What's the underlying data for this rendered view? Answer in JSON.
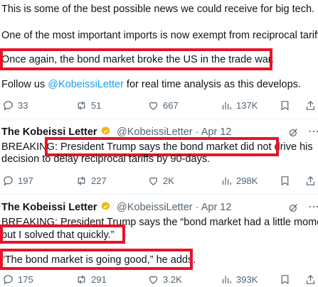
{
  "tweet1": {
    "line1": "This is some of the best possible news we could receive for big tech.",
    "line2": "One of the most important imports is now exempt from reciprocal tariffs.",
    "line3": "Once again, the bond market broke the US in the trade war.",
    "line4_prefix": "Follow us ",
    "line4_link": "@KobeissiLetter",
    "line4_suffix": " for real time analysis as this develops.",
    "replies": "33",
    "retweets": "51",
    "likes": "667",
    "views": "137K"
  },
  "tweet2": {
    "author": "The Kobeissi Letter",
    "handle_date": "@KobeissiLetter · Apr 12",
    "line1_prefix": "BREAKING",
    "line1_highlight": ": President Trump says the bond market did not drive",
    "line1_suffix": " his",
    "line2": "decision to delay reciprocal tariffs by 90-days.",
    "replies": "197",
    "retweets": "227",
    "likes": "2K",
    "views": "298K"
  },
  "tweet3": {
    "author": "The Kobeissi Letter",
    "handle_date": "@KobeissiLetter · Apr 12",
    "line1": "BREAKING: President Trump says the “bond market had a little moment,",
    "line2": "but I solved that quickly.”",
    "line3": "“The bond market is going good,” he adds.",
    "replies": "175",
    "retweets": "291",
    "likes": "3.2K",
    "views": "393K"
  },
  "colors": {
    "highlight_box": "#e8132a",
    "link": "#1d9bf0",
    "verified": "#f4b400",
    "muted": "#536471"
  }
}
